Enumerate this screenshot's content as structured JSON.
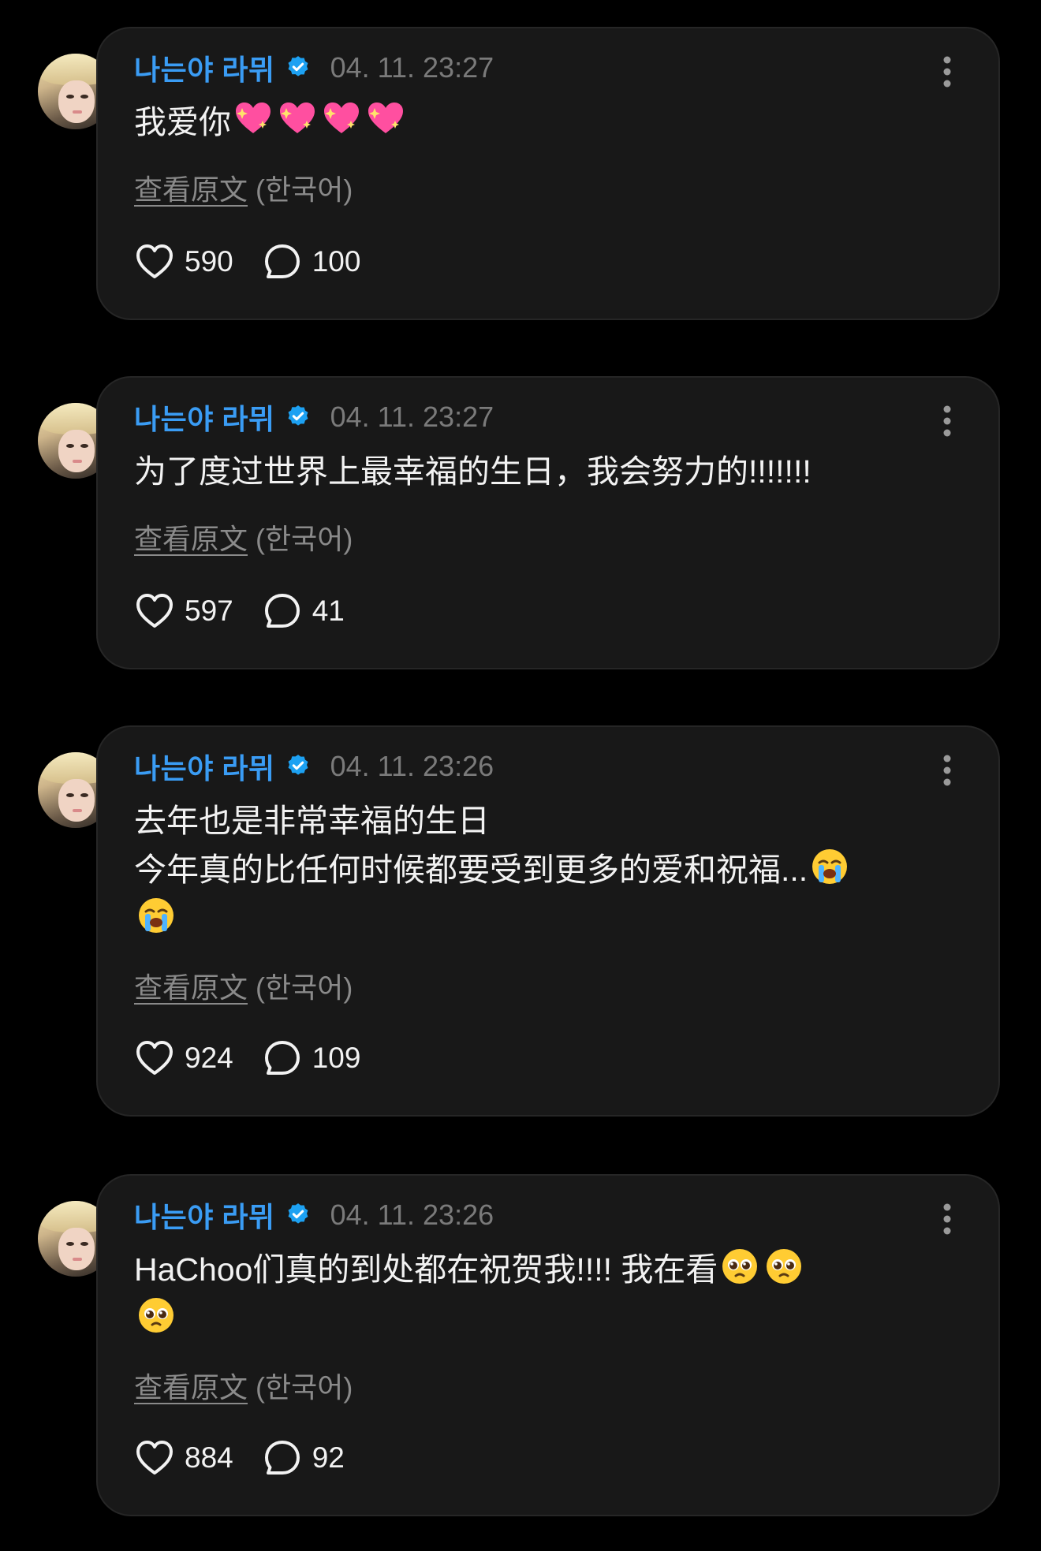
{
  "author": {
    "name": "나는야 라뮈",
    "verified": true,
    "verified_color": "#1da1f2"
  },
  "colors": {
    "background": "#000000",
    "card": "#181818",
    "name": "#3a9cf4",
    "meta": "#7a7a7a"
  },
  "posts": [
    {
      "date": "04. 11. 23:27",
      "lines": [
        "我爱你"
      ],
      "emoji": [
        "sparkling-heart",
        "sparkling-heart",
        "sparkling-heart",
        "sparkling-heart"
      ],
      "translate_link": "查看原文",
      "translate_lang": "(한국어)",
      "likes": "590",
      "comments": "100"
    },
    {
      "date": "04. 11. 23:27",
      "lines": [
        "为了度过世界上最幸福的生日，我会努力的!!!!!!!"
      ],
      "translate_link": "查看原文",
      "translate_lang": "(한국어)",
      "likes": "597",
      "comments": "41"
    },
    {
      "date": "04. 11. 23:26",
      "lines": [
        "去年也是非常幸福的生日",
        "今年真的比任何时候都要受到更多的爱和祝福..."
      ],
      "emoji": [
        "loudly-crying-face",
        "loudly-crying-face"
      ],
      "translate_link": "查看原文",
      "translate_lang": "(한국어)",
      "likes": "924",
      "comments": "109"
    },
    {
      "date": "04. 11. 23:26",
      "lines": [
        "HaChoo们真的到处都在祝贺我!!!!  我在看"
      ],
      "emoji": [
        "pleading-face",
        "pleading-face",
        "pleading-face"
      ],
      "translate_link": "查看原文",
      "translate_lang": "(한국어)",
      "likes": "884",
      "comments": "92"
    }
  ]
}
